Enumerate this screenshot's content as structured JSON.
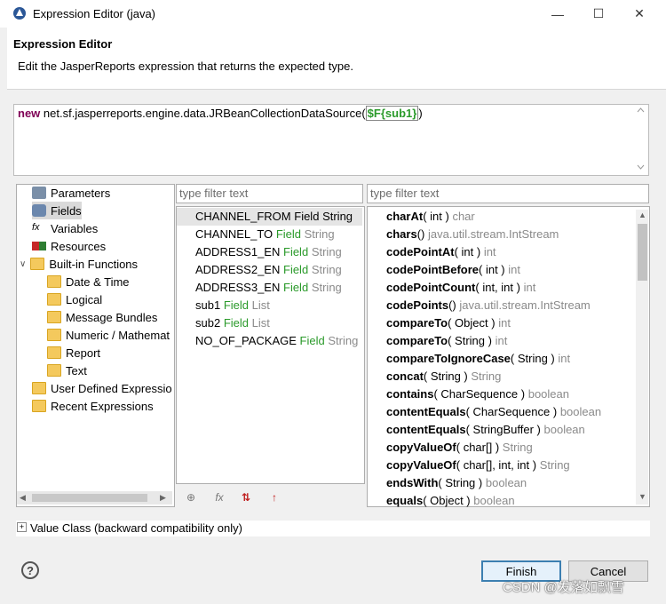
{
  "window": {
    "title": "Expression Editor (java)",
    "minimize_icon": "minimize-icon",
    "maximize_icon": "maximize-icon",
    "close_icon": "close-icon"
  },
  "header": {
    "title": "Expression Editor",
    "description": "Edit the JasperReports expression that returns the expected type."
  },
  "expression": {
    "keyword": "new",
    "class_name": " net.sf.jasperreports.engine.data.JRBeanCollectionDataSource(",
    "field_token": "$F{sub1}",
    "close_paren": ")"
  },
  "tree": {
    "items": [
      {
        "label": "Parameters",
        "icon": "parameters-icon"
      },
      {
        "label": "Fields",
        "icon": "fields-icon",
        "selected": true
      },
      {
        "label": "Variables",
        "icon": "variables-icon"
      },
      {
        "label": "Resources",
        "icon": "resources-icon"
      },
      {
        "label": "Built-in Functions",
        "icon": "folder-icon",
        "expanded": true
      },
      {
        "label": "Date & Time",
        "icon": "folder-icon"
      },
      {
        "label": "Logical",
        "icon": "folder-icon"
      },
      {
        "label": "Message Bundles",
        "icon": "folder-icon"
      },
      {
        "label": "Numeric / Mathemat",
        "icon": "folder-icon"
      },
      {
        "label": "Report",
        "icon": "folder-icon"
      },
      {
        "label": "Text",
        "icon": "folder-icon"
      },
      {
        "label": "User Defined Expressio",
        "icon": "folder-icon"
      },
      {
        "label": "Recent Expressions",
        "icon": "folder-icon"
      }
    ]
  },
  "fields_filter": {
    "placeholder": "type filter text"
  },
  "methods_filter": {
    "placeholder": "type filter text"
  },
  "fields": [
    {
      "name": "CHANNEL_FROM",
      "kind": "Field",
      "type": "String",
      "selected": true
    },
    {
      "name": "CHANNEL_TO",
      "kind": "Field",
      "type": "String"
    },
    {
      "name": "ADDRESS1_EN",
      "kind": "Field",
      "type": "String"
    },
    {
      "name": "ADDRESS2_EN",
      "kind": "Field",
      "type": "String"
    },
    {
      "name": "ADDRESS3_EN",
      "kind": "Field",
      "type": "String"
    },
    {
      "name": "sub1",
      "kind": "Field",
      "type": "List"
    },
    {
      "name": "sub2",
      "kind": "Field",
      "type": "List"
    },
    {
      "name": "NO_OF_PACKAGE",
      "kind": "Field",
      "type": "String"
    }
  ],
  "methods": [
    {
      "name": "charAt",
      "params": "( int )",
      "ret": "char"
    },
    {
      "name": "chars",
      "params": "()",
      "ret": "java.util.stream.IntStream"
    },
    {
      "name": "codePointAt",
      "params": "( int )",
      "ret": "int"
    },
    {
      "name": "codePointBefore",
      "params": "( int )",
      "ret": "int"
    },
    {
      "name": "codePointCount",
      "params": "( int, int )",
      "ret": "int"
    },
    {
      "name": "codePoints",
      "params": "()",
      "ret": "java.util.stream.IntStream"
    },
    {
      "name": "compareTo",
      "params": "( Object )",
      "ret": "int"
    },
    {
      "name": "compareTo",
      "params": "( String )",
      "ret": "int"
    },
    {
      "name": "compareToIgnoreCase",
      "params": "( String )",
      "ret": "int"
    },
    {
      "name": "concat",
      "params": "( String )",
      "ret": "String"
    },
    {
      "name": "contains",
      "params": "( CharSequence )",
      "ret": "boolean"
    },
    {
      "name": "contentEquals",
      "params": "( CharSequence )",
      "ret": "boolean"
    },
    {
      "name": "contentEquals",
      "params": "( StringBuffer )",
      "ret": "boolean"
    },
    {
      "name": "copyValueOf",
      "params": "( char[] )",
      "ret": "String"
    },
    {
      "name": "copyValueOf",
      "params": "( char[], int, int )",
      "ret": "String"
    },
    {
      "name": "endsWith",
      "params": "( String )",
      "ret": "boolean"
    },
    {
      "name": "equals",
      "params": "( Object )",
      "ret": "boolean"
    }
  ],
  "value_class": {
    "label": "Value Class (backward compatibility only)"
  },
  "buttons": {
    "finish": "Finish",
    "cancel": "Cancel",
    "help": "?"
  },
  "watermark": "CSDN @发落如飘雪"
}
